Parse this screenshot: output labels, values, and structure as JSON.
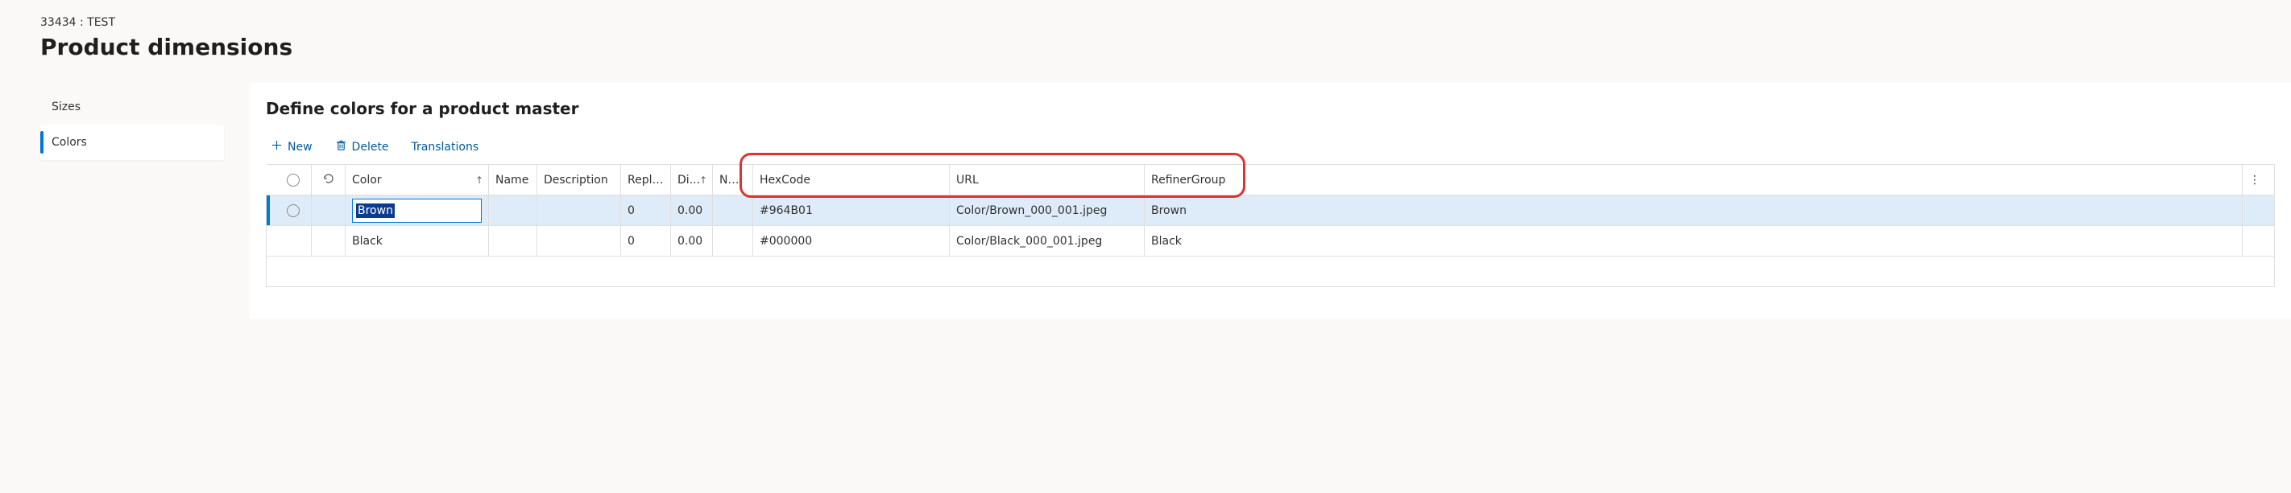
{
  "header": {
    "breadcrumb": "33434 : TEST",
    "title": "Product dimensions"
  },
  "sidebar": {
    "items": [
      {
        "label": "Sizes",
        "active": false
      },
      {
        "label": "Colors",
        "active": true
      }
    ]
  },
  "main": {
    "section_title": "Define colors for a product master",
    "toolbar": {
      "new_label": "New",
      "delete_label": "Delete",
      "translations_label": "Translations"
    },
    "grid": {
      "columns": {
        "color": "Color",
        "name": "Name",
        "description": "Description",
        "replenishment": "Repleni...",
        "display_order": "Di...",
        "number": "Num...",
        "hexcode": "HexCode",
        "url": "URL",
        "refiner_group": "RefinerGroup"
      },
      "rows": [
        {
          "selected": true,
          "editing": true,
          "color": "Brown",
          "name": "",
          "description": "",
          "replenishment": "0",
          "display_order": "0.00",
          "number": "",
          "hexcode": "#964B01",
          "url": "Color/Brown_000_001.jpeg",
          "refiner_group": "Brown"
        },
        {
          "selected": false,
          "editing": false,
          "color": "Black",
          "name": "",
          "description": "",
          "replenishment": "0",
          "display_order": "0.00",
          "number": "",
          "hexcode": "#000000",
          "url": "Color/Black_000_001.jpeg",
          "refiner_group": "Black"
        }
      ]
    }
  }
}
